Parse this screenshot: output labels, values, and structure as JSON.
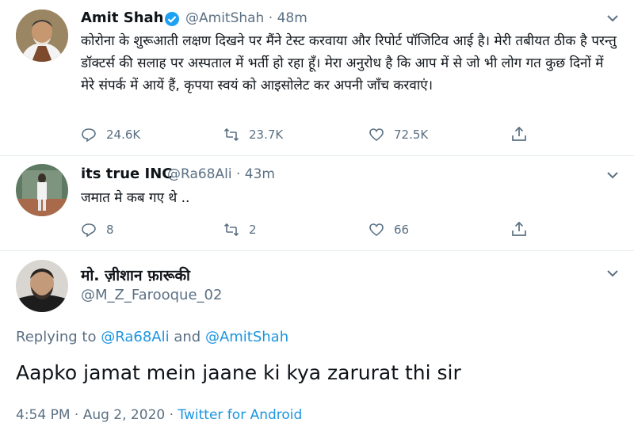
{
  "tweet1": {
    "name": "Amit Shah",
    "handle": "@AmitShah",
    "dot": "·",
    "time": "48m",
    "text": "कोरोना के शुरूआती लक्षण दिखने पर मैंने टेस्ट करवाया और रिपोर्ट पॉजिटिव आई है। मेरी तबीयत ठीक है परन्तु डॉक्टर्स की सलाह पर अस्पताल में भर्ती हो रहा हूँ। मेरा अनुरोध है कि आप में से जो भी लोग गत कुछ दिनों में मेरे संपर्क में आयें हैं, कृपया स्वयं को आइसोलेट कर अपनी जाँच करवाएं।",
    "replies": "24.6K",
    "retweets": "23.7K",
    "likes": "72.5K"
  },
  "tweet2": {
    "name": "its true INC",
    "handle": "@Ra68Ali",
    "dot": "·",
    "time": "43m",
    "text": "जमात मे कब गए थे ..",
    "replies": "8",
    "retweets": "2",
    "likes": "66"
  },
  "tweet3": {
    "name": "मो. ज़ीशान फ़ारूकी",
    "handle": "@M_Z_Farooque_02",
    "replying_prefix": "Replying to",
    "replying_user1": "@Ra68Ali",
    "replying_and": "and",
    "replying_user2": "@AmitShah",
    "text": "Aapko jamat mein jaane ki kya zarurat thi sir",
    "timestamp": "4:54 PM · Aug 2, 2020 ·",
    "source": "Twitter for Android"
  },
  "colors": {
    "accent": "#1b95e0",
    "muted": "#5b7083",
    "verified": "#1da1f2"
  }
}
